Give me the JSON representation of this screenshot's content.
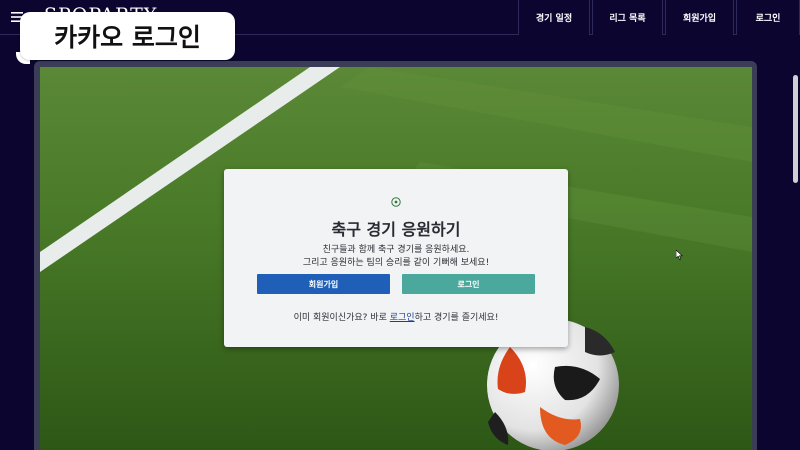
{
  "nav": {
    "brand": "SPOPARTY",
    "items": [
      {
        "label": "경기 일정"
      },
      {
        "label": "리그 목록"
      },
      {
        "label": "회원가입"
      },
      {
        "label": "로그인"
      }
    ]
  },
  "caption": {
    "text": "카카오 로그인"
  },
  "card": {
    "icon": "soccer-ball-icon",
    "title": "축구 경기 응원하기",
    "line1": "친구들과 함께 축구 경기를 응원하세요.",
    "line2": "그리고 응원하는 팀의 승리를 같이 기뻐해 보세요!",
    "signup_label": "회원가입",
    "login_label": "로그인",
    "footer_prefix": "이미 회원이신가요? 바로 ",
    "footer_link": "로그인",
    "footer_suffix": "하고 경기를 즐기세요!"
  },
  "colors": {
    "nav_bg": "#0c0530",
    "signup_button": "#1f5fb8",
    "login_button": "#4aa89c",
    "card_bg": "#f2f3f5"
  }
}
